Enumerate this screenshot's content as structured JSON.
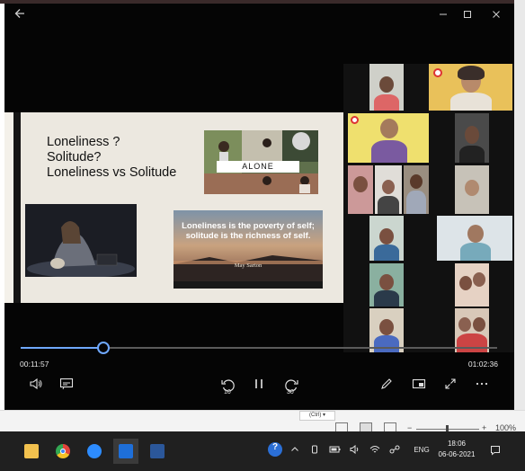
{
  "window": {
    "back_icon": "arrow-left-icon",
    "minimize_icon": "minimize-icon",
    "maximize_icon": "maximize-icon",
    "close_icon": "close-icon"
  },
  "slide": {
    "title_lines": [
      "Loneliness ?",
      "Solitude?",
      "Loneliness vs Solitude"
    ],
    "alone_label": "ALONE",
    "quote_text": "Loneliness is the poverty of self; solitude is the richness of self.",
    "quote_author": "May Sarton"
  },
  "player": {
    "current_time": "00:11:57",
    "total_time": "01:02:36",
    "progress": 0.173,
    "controls": {
      "volume_icon": "volume-icon",
      "subtitles_icon": "subtitles-icon",
      "rewind_label": "10",
      "play_pause_icon": "pause-icon",
      "forward_label": "30",
      "edit_icon": "pencil-icon",
      "miniview_icon": "mini-view-icon",
      "fullscreen_icon": "fullscreen-icon",
      "more_icon": "more-icon"
    }
  },
  "word_status": {
    "paste_tag": "(Ctrl) ▾",
    "zoom_minus": "−",
    "zoom_plus": "+",
    "zoom_level": "100%",
    "zoom_fraction": 0.5
  },
  "taskbar": {
    "apps": [
      {
        "name": "file-explorer",
        "color": "#f2c14e"
      },
      {
        "name": "chrome",
        "color": "#e2453c"
      },
      {
        "name": "zoom",
        "color": "#2d8cff"
      },
      {
        "name": "media-player",
        "color": "#1e6fd9"
      },
      {
        "name": "word",
        "color": "#2b579a"
      }
    ],
    "language": "ENG",
    "time": "18:06",
    "date": "06-06-2021"
  }
}
